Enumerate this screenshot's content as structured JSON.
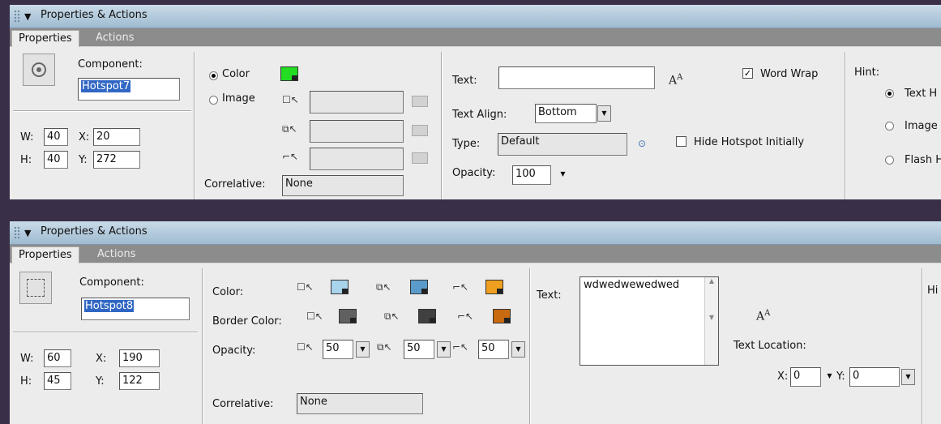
{
  "panel1": {
    "title": "Properties & Actions",
    "tab_properties": "Properties",
    "tab_actions": "Actions",
    "component_label": "Component:",
    "component_name": "Hotspot7",
    "w_label": "W:",
    "w_value": "40",
    "x_label": "X:",
    "x_value": "20",
    "h_label": "H:",
    "h_value": "40",
    "y_label": "Y:",
    "y_value": "272",
    "color_radio_label": "Color",
    "image_radio_label": "Image",
    "color_swatch": "#22dd22",
    "correlative_label": "Correlative:",
    "correlative_value": "None",
    "text_label": "Text:",
    "text_value": "",
    "text_align_label": "Text Align:",
    "text_align_value": "Bottom",
    "type_label": "Type:",
    "type_value": "Default",
    "opacity_label": "Opacity:",
    "opacity_value": "100",
    "word_wrap_label": "Word Wrap",
    "hide_hotspot_label": "Hide Hotspot Initially",
    "hint_label": "Hint:",
    "hint_options": [
      "Text H",
      "Image",
      "Flash H"
    ]
  },
  "panel2": {
    "title": "Properties & Actions",
    "tab_properties": "Properties",
    "tab_actions": "Actions",
    "component_label": "Component:",
    "component_name": "Hotspot8",
    "w_label": "W:",
    "w_value": "60",
    "x_label": "X:",
    "x_value": "190",
    "h_label": "H:",
    "h_value": "45",
    "y_label": "Y:",
    "y_value": "122",
    "color_label": "Color:",
    "border_color_label": "Border Color:",
    "opacity_label": "Opacity:",
    "color_swatches": [
      "#a8d4ec",
      "#5b9bcb",
      "#f0a020"
    ],
    "border_swatches": [
      "#606060",
      "#404040",
      "#c86a10"
    ],
    "opacity_values": [
      "50",
      "50",
      "50"
    ],
    "correlative_label": "Correlative:",
    "correlative_value": "None",
    "text_label": "Text:",
    "text_value": "wdwedwewedwed",
    "text_location_label": "Text Location:",
    "x_loc_label": "X:",
    "x_loc_value": "0",
    "y_loc_label": "Y:",
    "y_loc_value": "0",
    "hint_label": "Hi"
  }
}
